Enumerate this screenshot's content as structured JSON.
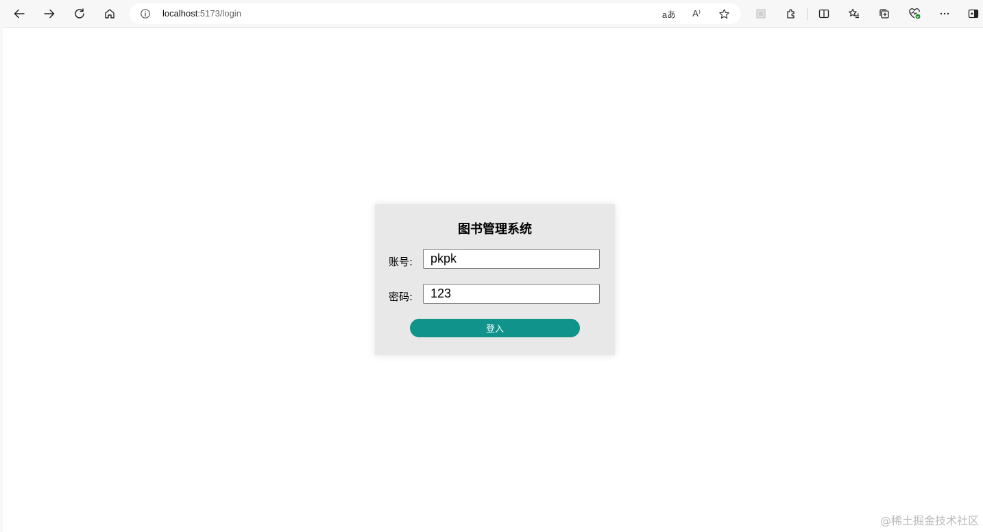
{
  "browser": {
    "url_host": "localhost",
    "url_path": ":5173/login",
    "icons": {
      "back": "back-arrow-icon",
      "forward": "forward-arrow-icon",
      "refresh": "refresh-icon",
      "home": "home-icon",
      "site_info": "info-icon",
      "translate_glyph": "aあ",
      "read_aloud_glyph": "A⁾",
      "favorite": "star-icon",
      "extensions": "puzzle-icon",
      "split_screen": "split-screen-icon",
      "favorites": "favorites-list-icon",
      "collections": "collections-icon",
      "browser_essentials": "heart-pulse-icon",
      "more": "more-icon",
      "sidebar": "sidebar-icon"
    }
  },
  "login": {
    "title": "图书管理系统",
    "account_label": "账号:",
    "account_value": "pkpk",
    "password_label": "密码:",
    "password_value": "123",
    "submit_label": "登入"
  },
  "watermark": "@稀土掘金技术社区",
  "colors": {
    "accent": "#0f938b",
    "card_bg": "#e8e8e8",
    "page_bg": "#ffffff"
  }
}
